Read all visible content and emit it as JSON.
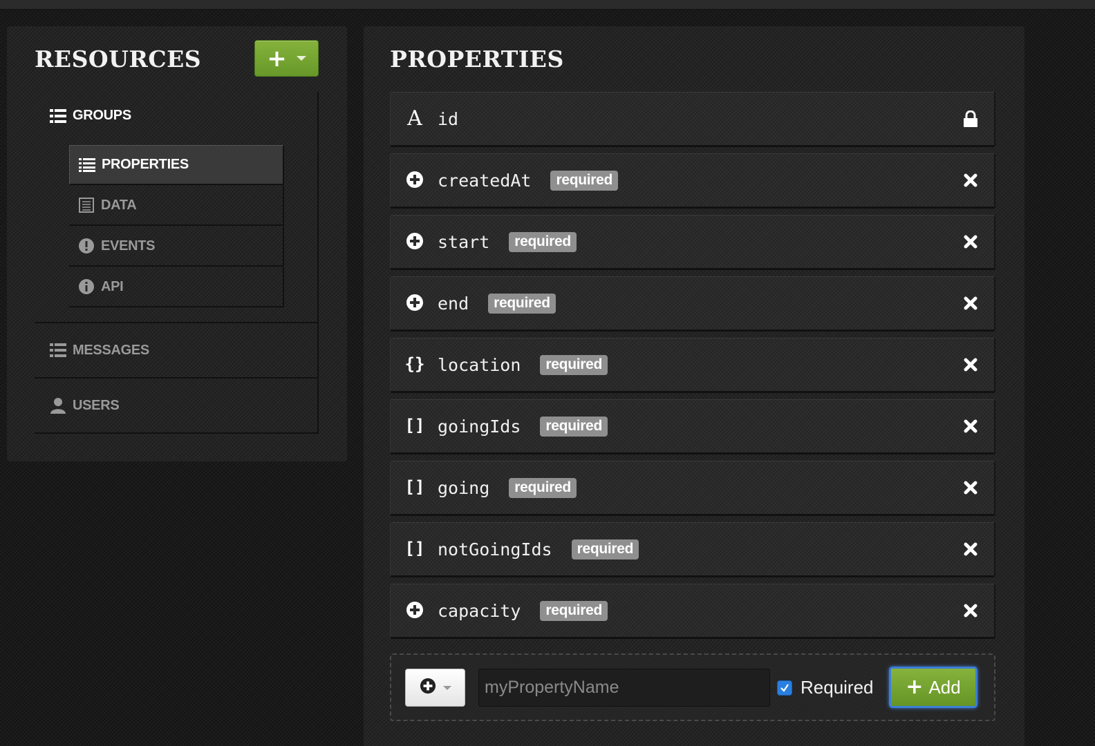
{
  "left_panel": {
    "title": "RESOURCES",
    "add_button_icon": "plus-icon",
    "nav": {
      "groups_label": "GROUPS",
      "sub_items": [
        {
          "label": "PROPERTIES",
          "icon": "list-icon",
          "active": true
        },
        {
          "label": "DATA",
          "icon": "table-icon",
          "active": false
        },
        {
          "label": "EVENTS",
          "icon": "exclamation-icon",
          "active": false
        },
        {
          "label": "API",
          "icon": "info-icon",
          "active": false
        }
      ],
      "messages_label": "MESSAGES",
      "users_label": "USERS"
    }
  },
  "right_panel": {
    "title": "PROPERTIES",
    "properties": [
      {
        "name": "id",
        "type_icon": "string-icon",
        "badge": "",
        "action": "lock-icon"
      },
      {
        "name": "createdAt",
        "type_icon": "number-icon",
        "badge": "required",
        "action": "remove-icon"
      },
      {
        "name": "start",
        "type_icon": "number-icon",
        "badge": "required",
        "action": "remove-icon"
      },
      {
        "name": "end",
        "type_icon": "number-icon",
        "badge": "required",
        "action": "remove-icon"
      },
      {
        "name": "location",
        "type_icon": "object-icon",
        "badge": "required",
        "action": "remove-icon"
      },
      {
        "name": "goingIds",
        "type_icon": "array-icon",
        "badge": "required",
        "action": "remove-icon"
      },
      {
        "name": "going",
        "type_icon": "array-icon",
        "badge": "required",
        "action": "remove-icon"
      },
      {
        "name": "notGoingIds",
        "type_icon": "array-icon",
        "badge": "required",
        "action": "remove-icon"
      },
      {
        "name": "capacity",
        "type_icon": "number-icon",
        "badge": "required",
        "action": "remove-icon"
      }
    ],
    "add_form": {
      "name_placeholder": "myPropertyName",
      "required_label": "Required",
      "required_checked": true,
      "add_label": "Add"
    }
  },
  "colors": {
    "accent_green": "#76a833",
    "badge_gray": "#8f8f8f",
    "checkbox_blue": "#2a7fe0"
  }
}
